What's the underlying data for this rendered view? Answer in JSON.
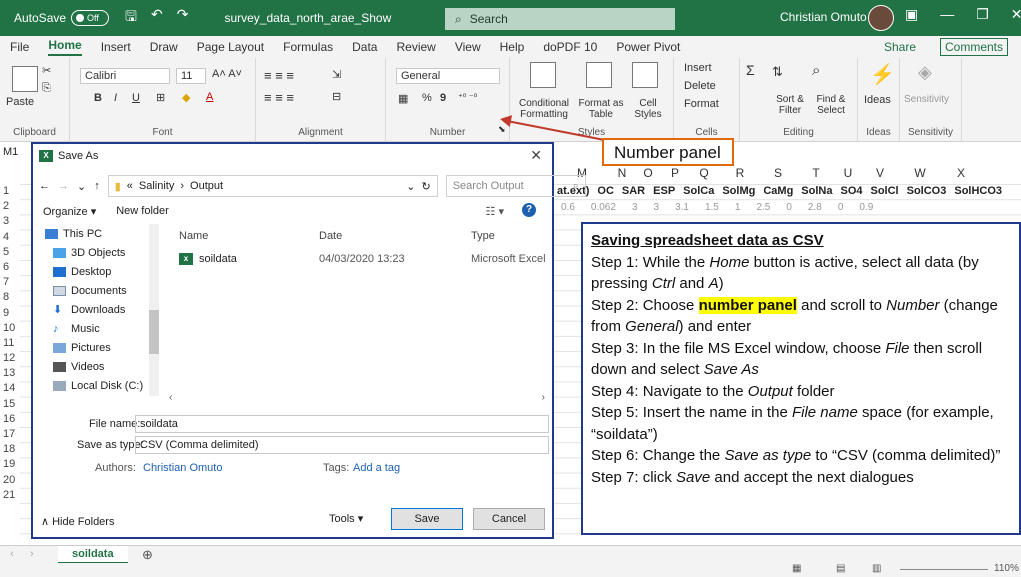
{
  "titlebar": {
    "autosave_label": "AutoSave",
    "autosave_state": "Off",
    "document_title": "survey_data_north_arae_Show",
    "search_label": "Search",
    "user_name": "Christian Omuto"
  },
  "ribbon_tabs": [
    "File",
    "Home",
    "Insert",
    "Draw",
    "Page Layout",
    "Formulas",
    "Data",
    "Review",
    "View",
    "Help",
    "doPDF 10",
    "Power Pivot"
  ],
  "ribbon_actions": {
    "share": "Share",
    "comments": "Comments"
  },
  "ribbon": {
    "clipboard": {
      "paste": "Paste",
      "label": "Clipboard"
    },
    "font": {
      "name": "Calibri",
      "size": "11",
      "label": "Font",
      "bold": "B",
      "italic": "I",
      "underline": "U"
    },
    "alignment": {
      "label": "Alignment"
    },
    "number": {
      "format": "General",
      "label": "Number",
      "percent": "%",
      "comma": "9"
    },
    "styles": {
      "conditional": "Conditional Formatting",
      "format_table": "Format as Table",
      "cell_styles": "Cell Styles",
      "label": "Styles"
    },
    "cells": {
      "insert": "Insert",
      "delete": "Delete",
      "format": "Format",
      "label": "Cells"
    },
    "editing": {
      "sort": "Sort & Filter",
      "find": "Find & Select",
      "label": "Editing"
    },
    "ideas": {
      "button": "Ideas",
      "label": "Ideas"
    },
    "sensitivity": {
      "button": "Sensitivity",
      "label": "Sensitivity"
    }
  },
  "namebox": "M1",
  "columns": [
    "M",
    "N",
    "O",
    "P",
    "Q",
    "R",
    "S",
    "T",
    "U",
    "V",
    "W",
    "X"
  ],
  "header_row": [
    "at.ext)",
    "OC",
    "SAR",
    "ESP",
    "SolCa",
    "SolMg",
    "CaMg",
    "SolNa",
    "SO4",
    "SolCl",
    "SolCO3",
    "SolHCO3"
  ],
  "row2": [
    "0.6",
    "0.062",
    "3",
    "3",
    "3.1",
    "1.5",
    "1",
    "2.5",
    "0",
    "2.8",
    "0",
    "0.9"
  ],
  "row_numbers": [
    "1",
    "2",
    "3",
    "4",
    "5",
    "6",
    "7",
    "8",
    "9",
    "10",
    "11",
    "12",
    "13",
    "14",
    "15",
    "16",
    "17",
    "18",
    "19",
    "20",
    "21"
  ],
  "callout": "Number panel",
  "instructions": {
    "heading": "Saving spreadsheet data as CSV",
    "s1a": "Step 1: While the ",
    "s1_home": "Home",
    "s1b": " button is active, select all data (by pressing ",
    "s1_ctrl": "Ctrl",
    "s1c": " and ",
    "s1_a": "A",
    "s1d": ")",
    "s2a": "Step 2: Choose ",
    "s2_hl": "number panel",
    "s2b": " and scroll to ",
    "s2_number": "Number",
    "s2c": " (change from ",
    "s2_general": "General",
    "s2d": ") and enter",
    "s3a": "Step 3: In the file MS Excel window, choose ",
    "s3_file": "File",
    "s3b": " then scroll down and select ",
    "s3_saveas": "Save As",
    "s4a": "Step 4: Navigate to the ",
    "s4_output": "Output",
    "s4b": " folder",
    "s5a": "Step 5: Insert the name in the ",
    "s5_filename": "File name",
    "s5b": "  space (for example, “soildata”)",
    "s6a": "Step 6:  Change the ",
    "s6_saveas": "Save as type",
    "s6b": " to “CSV (comma delimited)”",
    "s7a": "Step 7: click ",
    "s7_save": "Save",
    "s7b": " and accept the next dialogues"
  },
  "dialog": {
    "title": "Save As",
    "path": [
      "Salinity",
      "Output"
    ],
    "search_placeholder": "Search Output",
    "organize": "Organize",
    "new_folder": "New folder",
    "nav": [
      "This PC",
      "3D Objects",
      "Desktop",
      "Documents",
      "Downloads",
      "Music",
      "Pictures",
      "Videos",
      "Local Disk (C:)"
    ],
    "columns": [
      "Name",
      "Date",
      "Type"
    ],
    "file": {
      "name": "soildata",
      "date": "04/03/2020 13:23",
      "type": "Microsoft Excel Co"
    },
    "file_name_label": "File name:",
    "file_name_value": "soildata",
    "save_type_label": "Save as type:",
    "save_type_value": "CSV (Comma delimited)",
    "authors_label": "Authors:",
    "authors_value": "Christian Omuto",
    "tags_label": "Tags:",
    "tags_value": "Add a tag",
    "hide_folders": "Hide Folders",
    "tools": "Tools",
    "save": "Save",
    "cancel": "Cancel"
  },
  "sheet_tab": "soildata",
  "zoom": "110%"
}
